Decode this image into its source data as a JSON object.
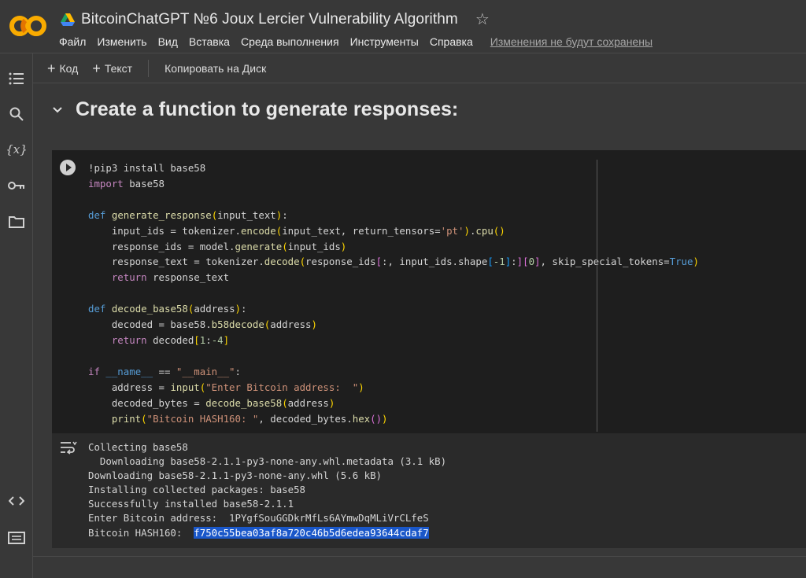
{
  "app": {
    "title": "BitcoinChatGPT №6 Joux Lercier Vulnerability Algorithm",
    "logo_colors": {
      "primary": "#f9ab00",
      "secondary": "#e37400"
    }
  },
  "menu": {
    "items": [
      "Файл",
      "Изменить",
      "Вид",
      "Вставка",
      "Среда выполнения",
      "Инструменты",
      "Справка"
    ],
    "unsaved": "Изменения не будут сохранены"
  },
  "toolbar": {
    "code_label": "Код",
    "text_label": "Текст",
    "copy_label": "Копировать на Диск"
  },
  "sidebar": {
    "icons": [
      "toc-icon",
      "search-icon",
      "variables-icon",
      "key-icon",
      "folder-icon",
      "code-snippets-icon",
      "terminal-icon"
    ]
  },
  "section": {
    "title": "Create a function to generate responses:"
  },
  "code_lines": [
    "!pip3 install base58",
    "import base58",
    "",
    "def generate_response(input_text):",
    "    input_ids = tokenizer.encode(input_text, return_tensors='pt').cpu()",
    "    response_ids = model.generate(input_ids)",
    "    response_text = tokenizer.decode(response_ids[:, input_ids.shape[-1]:][0], skip_special_tokens=True)",
    "    return response_text",
    "",
    "def decode_base58(address):",
    "    decoded = base58.b58decode(address)",
    "    return decoded[1:-4]",
    "",
    "if __name__ == \"__main__\":",
    "    address = input(\"Enter Bitcoin address:  \")",
    "    decoded_bytes = decode_base58(address)",
    "    print(\"Bitcoin HASH160: \", decoded_bytes.hex())"
  ],
  "output": {
    "lines": [
      "Collecting base58",
      "  Downloading base58-2.1.1-py3-none-any.whl.metadata (3.1 kB)",
      "Downloading base58-2.1.1-py3-none-any.whl (5.6 kB)",
      "Installing collected packages: base58",
      "Successfully installed base58-2.1.1",
      "Enter Bitcoin address:  1PYgfSouGGDkrMfLs6AYmwDqMLiVrCLfeS"
    ],
    "hash_prefix": "Bitcoin HASH160:  ",
    "hash_value": "f750c55bea03af8a720c46b5d6edea93644cdaf7"
  },
  "colors": {
    "background": "#383838",
    "code_bg": "#1e1e1e",
    "highlight": "#1a57c9"
  }
}
